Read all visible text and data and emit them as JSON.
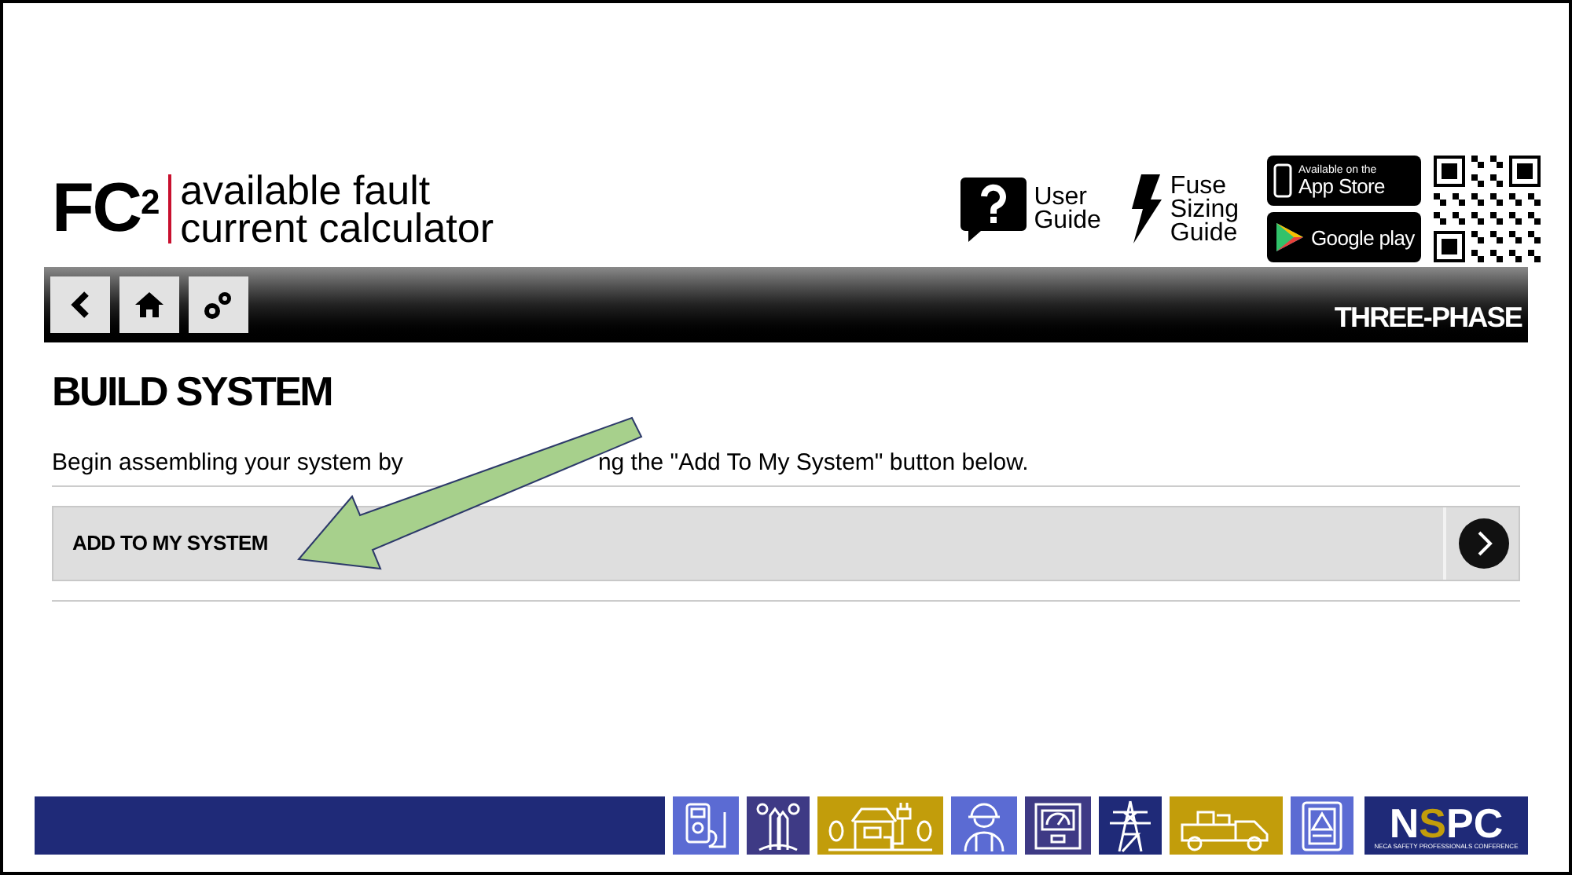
{
  "logo": {
    "mark": "FC",
    "superscript": "2",
    "line_1": "available fault",
    "line_2": "current calculator"
  },
  "header_links": [
    {
      "kind": "help",
      "lines": [
        "User",
        "Guide"
      ]
    },
    {
      "kind": "bolt",
      "lines": [
        "Fuse",
        "Sizing",
        "Guide"
      ]
    }
  ],
  "store_badges": [
    {
      "kind": "apple",
      "small": "Available on the",
      "large": "App Store"
    },
    {
      "kind": "google",
      "large": "Google play"
    }
  ],
  "toolbar": {
    "buttons": [
      {
        "kind": "back"
      },
      {
        "kind": "home"
      },
      {
        "kind": "settings"
      }
    ],
    "mode": "THREE-PHASE"
  },
  "page": {
    "title": "BUILD SYSTEM",
    "intro_before": "Begin assembling your system by",
    "intro_after": "ng the \"Add To My System\" button below.",
    "action": "ADD TO MY SYSTEM"
  },
  "footer": {
    "tiles": [
      {
        "kind": "meter",
        "color": "#5b6bd3"
      },
      {
        "kind": "cable",
        "color": "#3e3a85"
      },
      {
        "kind": "house",
        "color": "#c29d0b"
      },
      {
        "kind": "worker",
        "color": "#5b6bd3"
      },
      {
        "kind": "gauge",
        "color": "#3e3a85"
      },
      {
        "kind": "tower",
        "color": "#1f2a78"
      },
      {
        "kind": "truck",
        "color": "#c29d0b"
      },
      {
        "kind": "panel",
        "color": "#5b6bd3"
      }
    ],
    "sponsor": {
      "letters": [
        "N",
        "S",
        "PC"
      ],
      "tagline": "NECA SAFETY PROFESSIONALS CONFERENCE"
    }
  }
}
